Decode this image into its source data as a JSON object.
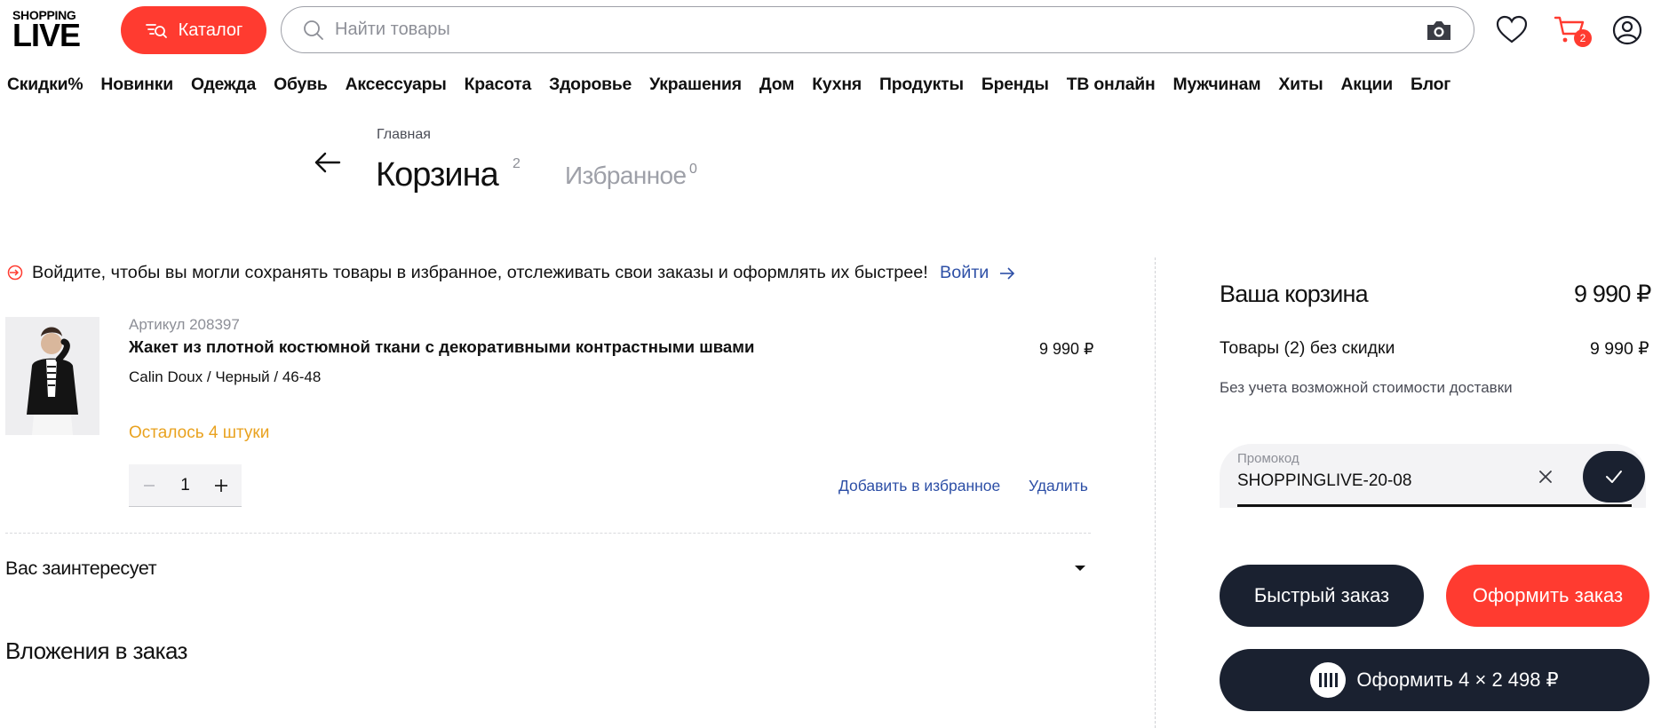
{
  "header": {
    "logo_top": "SHOPPING",
    "logo_bottom": "LIVE",
    "catalog_label": "Каталог",
    "search_placeholder": "Найти товары",
    "cart_count": "2",
    "accent_color": "#ff3b30"
  },
  "nav": [
    "Скидки%",
    "Новинки",
    "Одежда",
    "Обувь",
    "Аксессуары",
    "Красота",
    "Здоровье",
    "Украшения",
    "Дом",
    "Кухня",
    "Продукты",
    "Бренды",
    "ТВ онлайн",
    "Мужчинам",
    "Хиты",
    "Акции",
    "Блог"
  ],
  "page": {
    "breadcrumb": "Главная",
    "title": "Корзина",
    "title_count": "2",
    "favorites_tab": "Избранное",
    "favorites_count": "0"
  },
  "login_banner": {
    "text": "Войдите, чтобы вы могли сохранять товары в избранное, отслеживать свои заказы и оформлять их быстрее!",
    "link": "Войти"
  },
  "product": {
    "article": "Артикул 208397",
    "title": "Жакет из плотной костюмной ткани с декоративными контрастными швами",
    "price": "9 990 ₽",
    "meta": "Calin Doux / Черный / 46-48",
    "stock": "Осталось 4 штуки",
    "quantity": "1",
    "add_favorite": "Добавить в избранное",
    "remove": "Удалить"
  },
  "sections": {
    "interest": "Вас заинтересует",
    "attachments": "Вложения в заказ"
  },
  "summary": {
    "title": "Ваша корзина",
    "total": "9 990 ₽",
    "items_label": "Товары (2) без скидки",
    "items_price": "9 990 ₽",
    "note": "Без учета возможной стоимости доставки",
    "promo_label": "Промокод",
    "promo_value": "SHOPPINGLIVE-20-08",
    "quick_order": "Быстрый заказ",
    "checkout": "Оформить заказ",
    "split_pay": "Оформить 4 × 2 498 ₽"
  },
  "icons": {
    "catalog": "catalog-search-icon",
    "search": "search-icon",
    "camera": "camera-icon",
    "favorites": "heart-icon",
    "cart": "cart-icon",
    "profile": "user-icon",
    "back": "arrow-left-icon",
    "login": "login-icon",
    "arrow": "arrow-right-icon",
    "minus": "minus-icon",
    "plus": "plus-icon",
    "caret": "caret-down-icon",
    "clear": "close-icon",
    "apply": "check-icon",
    "split": "split-payment-icon"
  }
}
